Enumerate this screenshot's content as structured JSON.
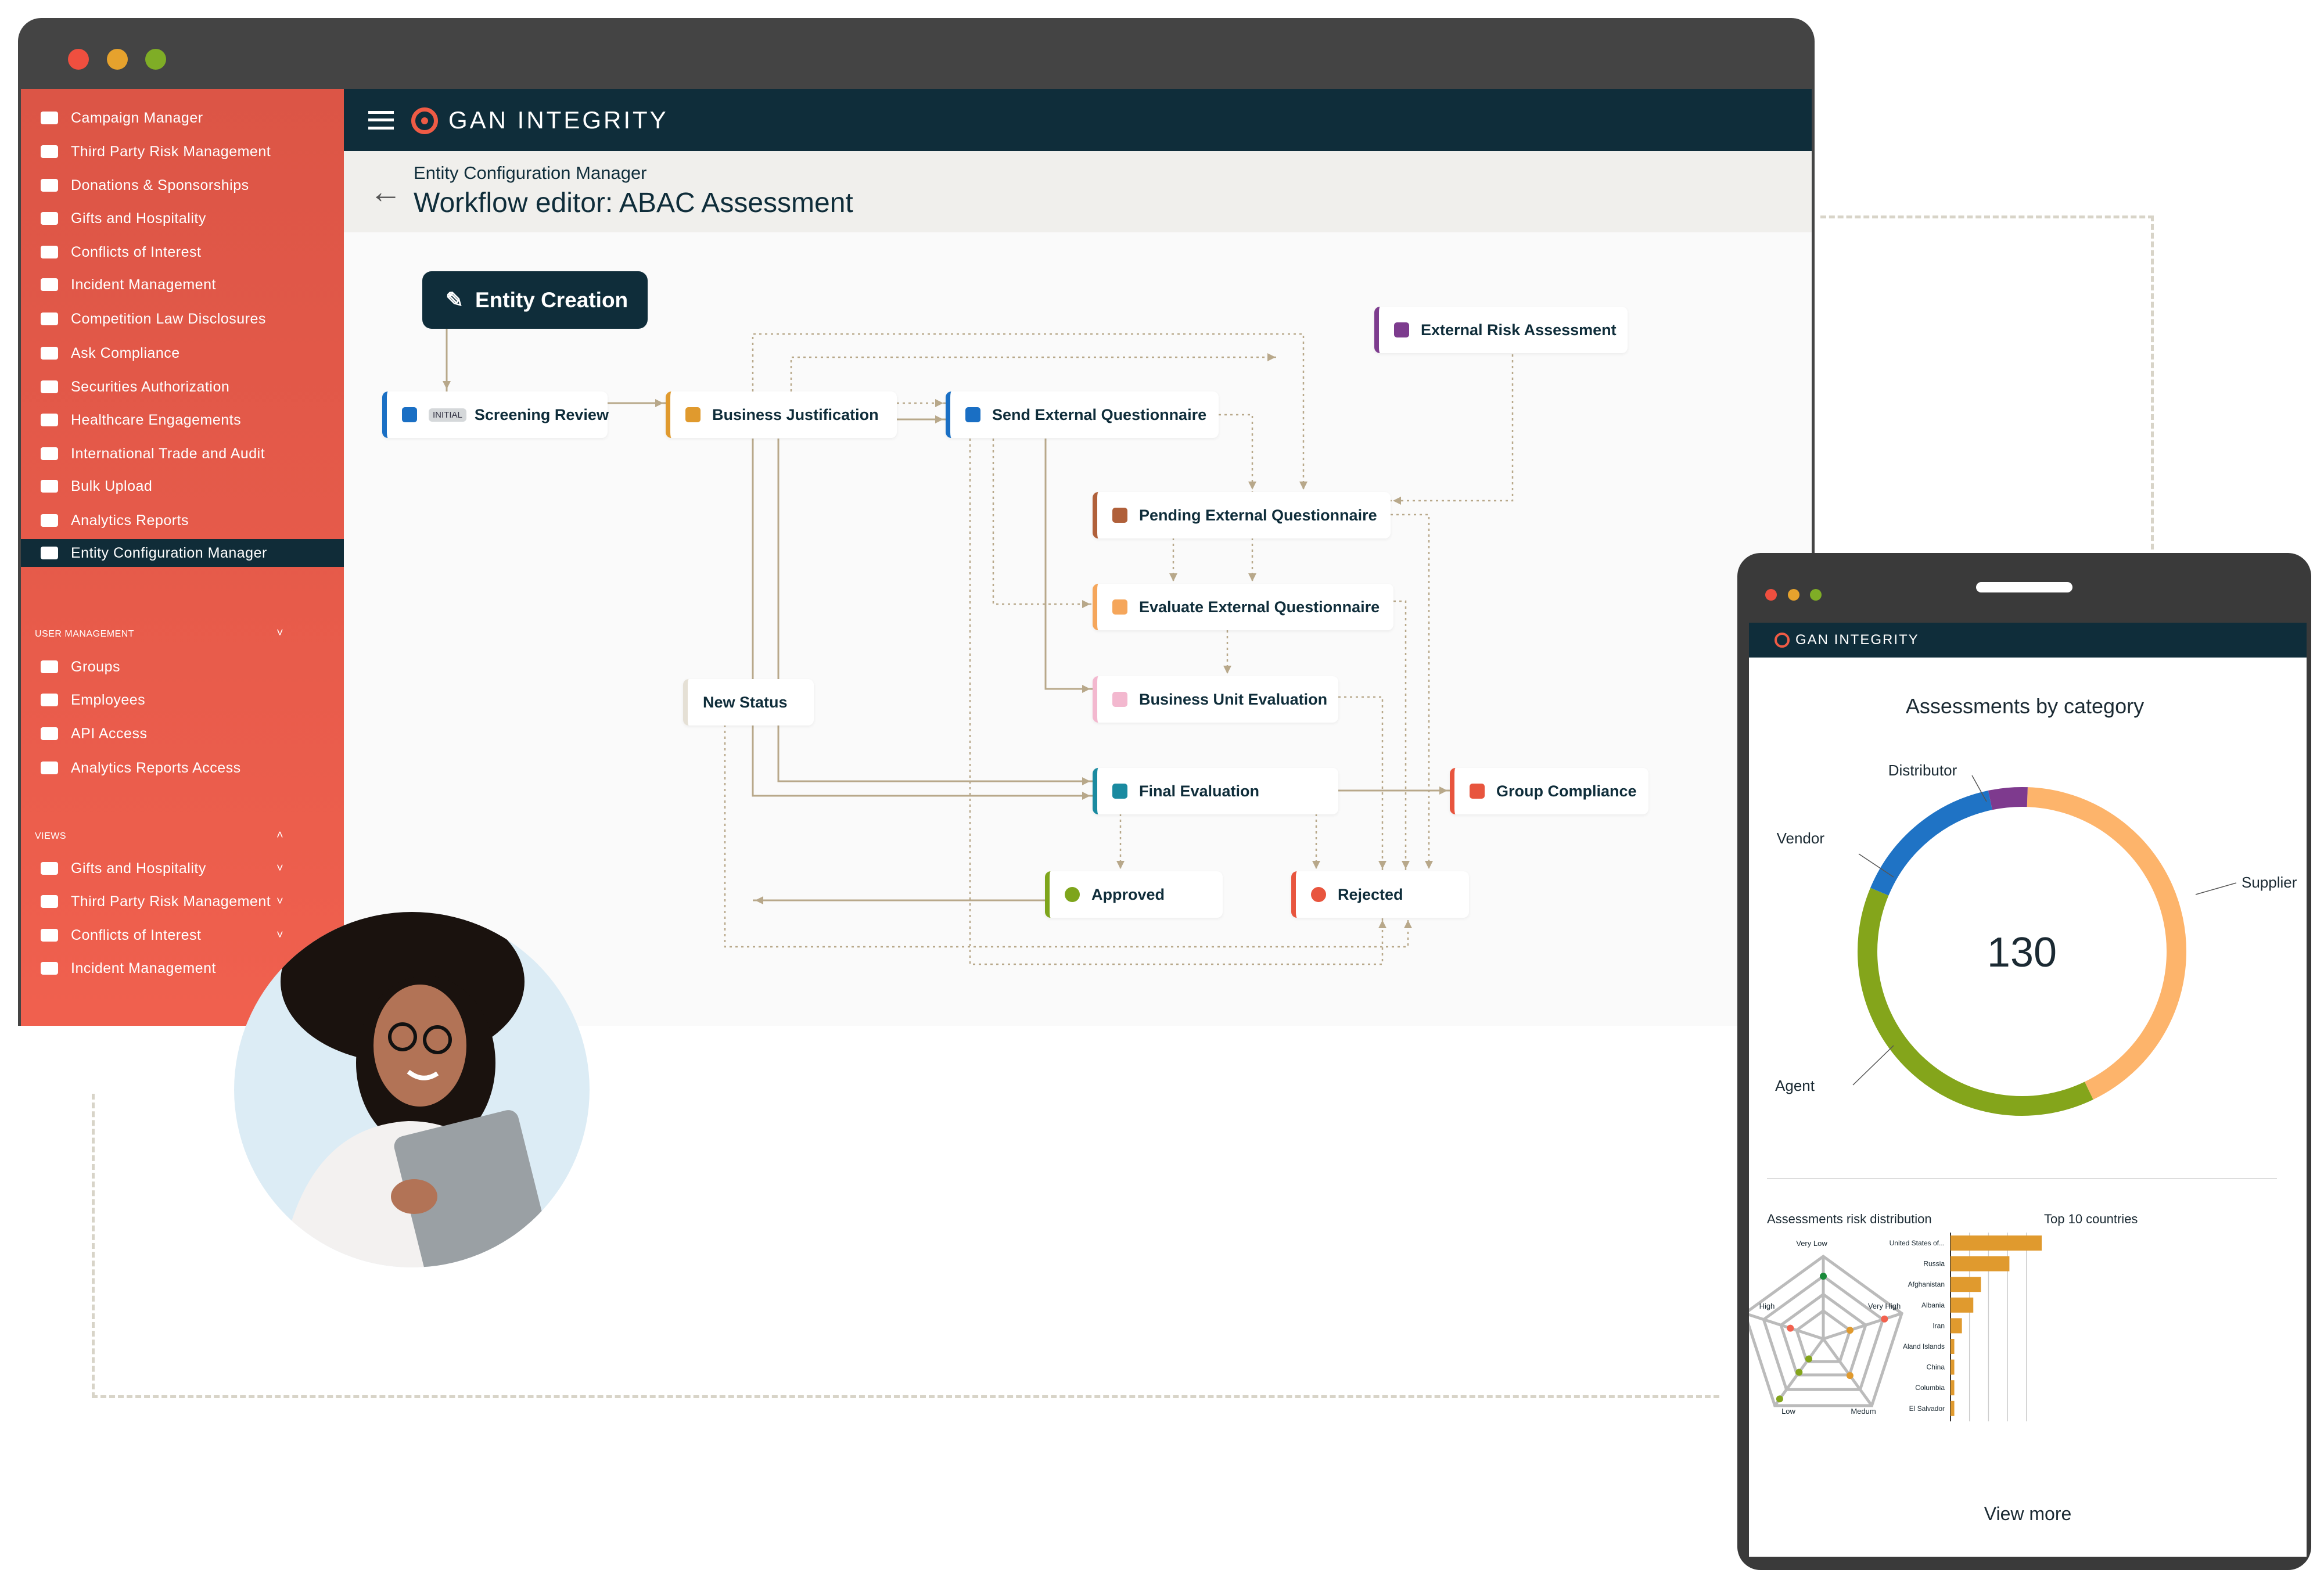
{
  "desktop": {
    "sidebar": {
      "items": [
        {
          "label": "Campaign Manager",
          "icon": "clipboard-icon"
        },
        {
          "label": "Third Party Risk Management",
          "icon": "globe-icon"
        },
        {
          "label": "Donations & Sponsorships",
          "icon": "graduation-cap-icon"
        },
        {
          "label": "Gifts and Hospitality",
          "icon": "cloche-icon"
        },
        {
          "label": "Conflicts of Interest",
          "icon": "briefcase-icon"
        },
        {
          "label": "Incident Management",
          "icon": "person-speaking-icon"
        },
        {
          "label": "Competition Law Disclosures",
          "icon": "aperture-icon"
        },
        {
          "label": "Ask Compliance",
          "icon": "globe-icon"
        },
        {
          "label": "Securities Authorization",
          "icon": "chart-box-icon"
        },
        {
          "label": "Healthcare Engagements",
          "icon": "medical-cross-icon"
        },
        {
          "label": "International Trade and Audit",
          "icon": "store-icon"
        },
        {
          "label": "Bulk Upload",
          "icon": "cloud-upload-icon"
        },
        {
          "label": "Analytics Reports",
          "icon": "bar-chart-icon"
        },
        {
          "label": "Entity Configuration Manager",
          "icon": "wrench-icon",
          "active": true
        }
      ],
      "user_management": {
        "title": "USER MANAGEMENT",
        "items": [
          {
            "label": "Groups",
            "icon": "groups-icon"
          },
          {
            "label": "Employees",
            "icon": "people-icon"
          },
          {
            "label": "API Access",
            "icon": "api-icon"
          },
          {
            "label": "Analytics Reports Access",
            "icon": "bar-chart-icon"
          }
        ]
      },
      "views": {
        "title": "VIEWS",
        "items": [
          {
            "label": "Gifts and Hospitality",
            "icon": "view-carousel-icon"
          },
          {
            "label": "Third Party Risk Management",
            "icon": "view-carousel-icon"
          },
          {
            "label": "Conflicts of Interest",
            "icon": "view-carousel-icon"
          },
          {
            "label": "Incident Management",
            "icon": "view-carousel-icon"
          }
        ]
      }
    },
    "header": {
      "brand": "GAN INTEGRITY"
    },
    "subheader": {
      "breadcrumb": "Entity Configuration Manager",
      "title": "Workflow editor: ABAC Assessment"
    },
    "workflow": {
      "start": "Entity Creation",
      "initial_badge": "INITIAL",
      "nodes": [
        {
          "id": "screening",
          "label": "Screening Review",
          "color": "#1a6fc4"
        },
        {
          "id": "bj",
          "label": "Business Justification",
          "color": "#e09a2e"
        },
        {
          "id": "seq",
          "label": "Send External Questionnaire",
          "color": "#1a6fc4"
        },
        {
          "id": "era",
          "label": "External Risk Assessment",
          "color": "#7d3c8e"
        },
        {
          "id": "peq",
          "label": "Pending External Questionnaire",
          "color": "#b0603a"
        },
        {
          "id": "eeq",
          "label": "Evaluate External Questionnaire",
          "color": "#f5a65b"
        },
        {
          "id": "bue",
          "label": "Business Unit Evaluation",
          "color": "#f3b8cf"
        },
        {
          "id": "new",
          "label": "New Status",
          "color": "#e5e0d5"
        },
        {
          "id": "fe",
          "label": "Final Evaluation",
          "color": "#1a8aa0"
        },
        {
          "id": "gc",
          "label": "Group Compliance",
          "color": "#e8553e"
        },
        {
          "id": "approved",
          "label": "Approved",
          "color": "#7ea51c"
        },
        {
          "id": "rejected",
          "label": "Rejected",
          "color": "#e8553e"
        }
      ]
    }
  },
  "mobile": {
    "brand": "GAN INTEGRITY",
    "view_more": "View more",
    "chart_data": [
      {
        "type": "pie",
        "donut": true,
        "title": "Assessments by category",
        "center_label": "130",
        "categories": [
          "Supplier",
          "Agent",
          "Vendor",
          "Distributor"
        ],
        "values": [
          55,
          50,
          20,
          5
        ],
        "colors": [
          "#fdb46b",
          "#84a51b",
          "#1f73c5",
          "#7e3a8e"
        ]
      },
      {
        "type": "radar",
        "title": "Assessments risk distribution",
        "axes": [
          "Very Low",
          "Very High",
          "Medum",
          "Low",
          "High"
        ],
        "points": [
          {
            "axis": "Very Low",
            "value": 0.76,
            "color": "#1a8a3a"
          },
          {
            "axis": "Very High",
            "value": 0.78,
            "color": "#f2614e"
          },
          {
            "axis": "Very High",
            "value": 0.34,
            "color": "#e09a2e"
          },
          {
            "axis": "Medum",
            "value": 0.55,
            "color": "#e09a2e"
          },
          {
            "axis": "Low",
            "value": 0.9,
            "color": "#84a51b"
          },
          {
            "axis": "Low",
            "value": 0.5,
            "color": "#84a51b"
          },
          {
            "axis": "Low",
            "value": 0.3,
            "color": "#84a51b"
          },
          {
            "axis": "High",
            "value": 0.42,
            "color": "#f2614e"
          }
        ],
        "levels": 4
      },
      {
        "type": "bar",
        "orientation": "horizontal",
        "title": "Top 10 countries",
        "categories": [
          "United States of...",
          "Russia",
          "Afghanistan",
          "Albania",
          "Iran",
          "Aland Islands",
          "China",
          "Columbia",
          "El Salvador"
        ],
        "values": [
          48,
          31,
          16,
          12,
          6,
          2,
          2,
          2,
          2
        ],
        "xlim": [
          0,
          50
        ],
        "grid": true,
        "color": "#e09a2e"
      }
    ]
  },
  "colors": {
    "sidebar": "#e85a49",
    "header": "#0f2d3a",
    "accent": "#e8553e",
    "connector": "#b8a88a"
  }
}
